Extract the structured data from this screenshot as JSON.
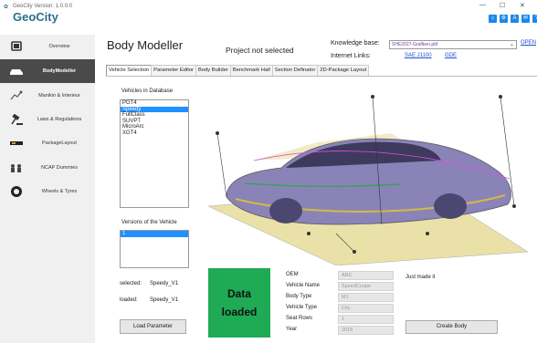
{
  "app": {
    "version_text": "GeoCity Version: 1.0.0.0",
    "logo": "GeoCity",
    "window_controls": [
      "—",
      "☐",
      "✕"
    ],
    "top_icons": [
      "⌂",
      "⚙",
      "A",
      "✉",
      "?"
    ]
  },
  "sidebar": {
    "items": [
      {
        "label": "Overview",
        "icon": "laptop-icon"
      },
      {
        "label": "BodyModeller",
        "icon": "car-icon",
        "active": true
      },
      {
        "label": "Manikin & Interieur",
        "icon": "manikin-icon"
      },
      {
        "label": "Laws & Regulations",
        "icon": "gavel-icon"
      },
      {
        "label": "PackageLayout",
        "icon": "package-layout-icon"
      },
      {
        "label": "NCAP Dummies",
        "icon": "dummies-icon"
      },
      {
        "label": "Wheels & Tyres",
        "icon": "wheel-icon"
      }
    ]
  },
  "header": {
    "title": "Body Modeller",
    "project_status": "Project not selected",
    "knowledge_base_label": "Knowledge base:",
    "knowledge_base_value": "SHE2027-Grafiken.pbf",
    "open_link": "OPEN",
    "internet_links_label": "Internet Links:",
    "internet_links": [
      "SAE J1100",
      "GDE"
    ]
  },
  "tabs": [
    "Vehicle Selection",
    "Parameter Editor",
    "Body Builder",
    "Benchmark Hall",
    "Section Definator",
    "2D-Package Layout"
  ],
  "vehicle_selection": {
    "vehicles_label": "Vehicles in Database",
    "vehicles": [
      "PGT4",
      "Speedy",
      "FullClass",
      "SUVPT",
      "MicroArc",
      "XGT4"
    ],
    "selected_vehicle_index": 1,
    "versions_label": "Versions of the Vehicle",
    "versions": [
      "1"
    ],
    "selected_version_index": 0,
    "selected_label": "selected:",
    "selected_value": "Speedy_V1",
    "loaded_label": "loaded:",
    "loaded_value": "Speedy_V1",
    "load_button": "Load Parameter",
    "status_line1": "Data",
    "status_line2": "loaded",
    "status_color": "#1faa55",
    "oem_fields": [
      {
        "label": "OEM",
        "value": "ARC"
      },
      {
        "label": "Vehicle Name",
        "value": "SpeedCoupe"
      },
      {
        "label": "Body Type",
        "value": "M1"
      },
      {
        "label": "Vehicle Type",
        "value": "City"
      },
      {
        "label": "Seat Rows",
        "value": "1"
      },
      {
        "label": "Year",
        "value": "2018"
      }
    ],
    "note": "Just made it",
    "create_button": "Create Body"
  }
}
